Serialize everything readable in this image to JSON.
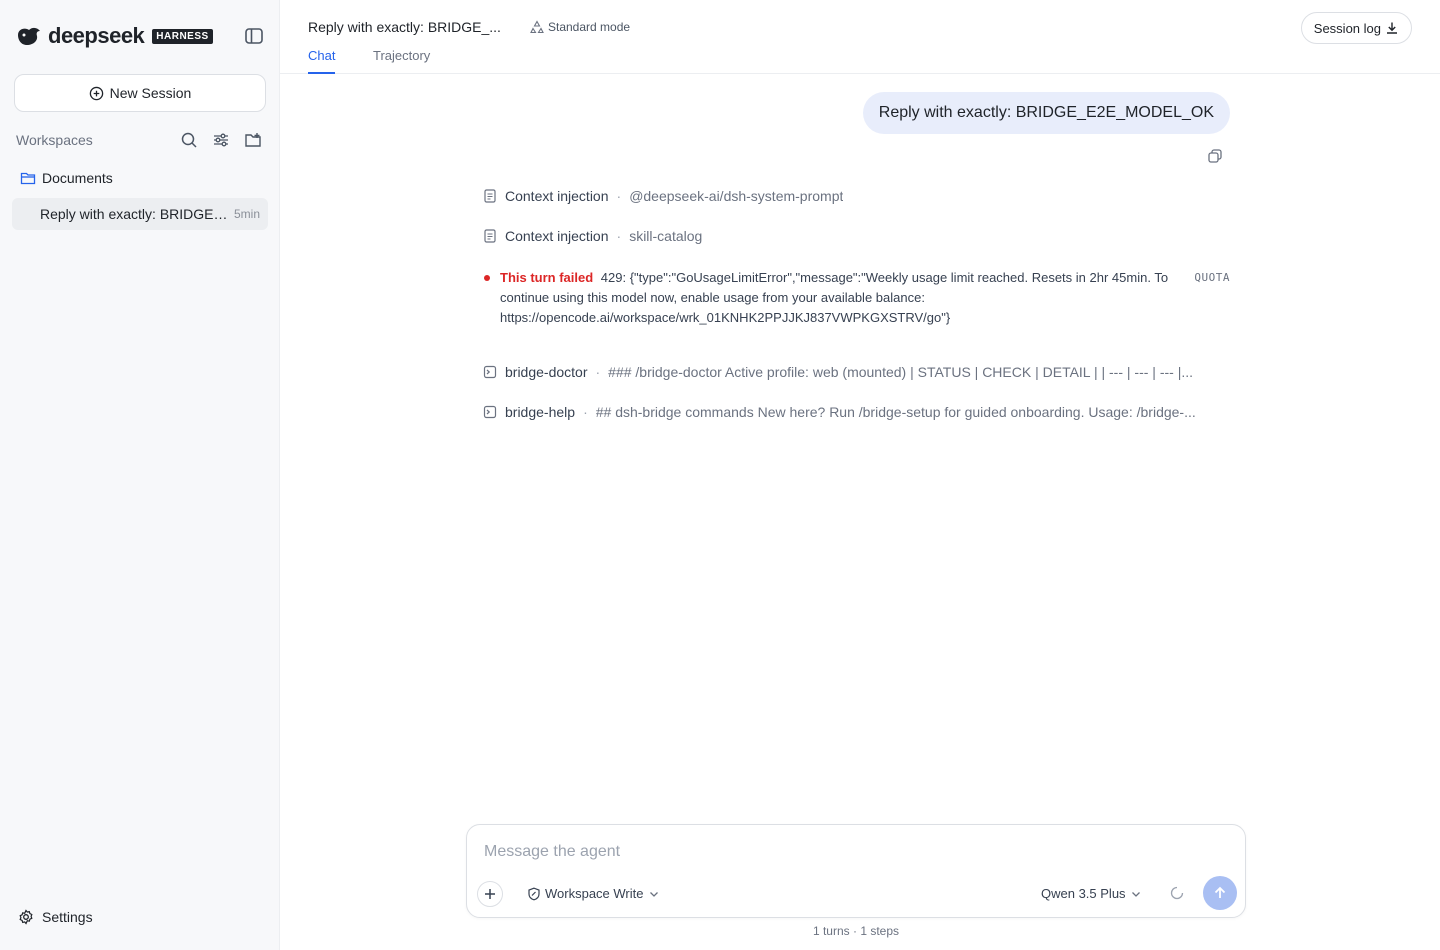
{
  "brand": {
    "name": "deepseek",
    "badge": "HARNESS"
  },
  "sidebar": {
    "new_session_label": "New Session",
    "workspaces_label": "Workspaces",
    "folder_name": "Documents",
    "sessions": [
      {
        "title": "Reply with exactly: BRIDGE_E2E_MODEL_OK",
        "age": "5min"
      }
    ],
    "settings_label": "Settings"
  },
  "header": {
    "title": "Reply with exactly: BRIDGE_...",
    "mode": "Standard mode",
    "tabs": [
      {
        "label": "Chat",
        "active": true
      },
      {
        "label": "Trajectory",
        "active": false
      }
    ],
    "session_log_label": "Session log"
  },
  "chat": {
    "user_message": "Reply with exactly: BRIDGE_E2E_MODEL_OK",
    "steps": [
      {
        "name": "Context injection",
        "detail": "@deepseek-ai/dsh-system-prompt",
        "icon": "document-icon"
      },
      {
        "name": "Context injection",
        "detail": "skill-catalog",
        "icon": "document-icon"
      }
    ],
    "error": {
      "label": "This turn failed",
      "message": "429: {\"type\":\"GoUsageLimitError\",\"message\":\"Weekly usage limit reached. Resets in 2hr 45min. To continue using this model now, enable usage from your available balance: https://opencode.ai/workspace/wrk_01KNHK2PPJJKJ837VWPKGXSTRV/go\"}",
      "tag": "QUOTA"
    },
    "commands": [
      {
        "name": "bridge-doctor",
        "detail": "### /bridge-doctor Active profile: web (mounted) | STATUS | CHECK | DETAIL | | --- | --- | --- |...",
        "icon": "terminal-icon"
      },
      {
        "name": "bridge-help",
        "detail": "## dsh-bridge commands New here? Run /bridge-setup for guided onboarding. Usage: /bridge-...",
        "icon": "terminal-icon"
      }
    ]
  },
  "composer": {
    "placeholder": "Message the agent",
    "permission_label": "Workspace Write",
    "model_label": "Qwen 3.5 Plus",
    "stats": "1 turns · 1 steps"
  },
  "colors": {
    "accent": "#2563eb",
    "error": "#dc2626",
    "bubble": "#e8edfb",
    "send": "#a9bff3"
  }
}
